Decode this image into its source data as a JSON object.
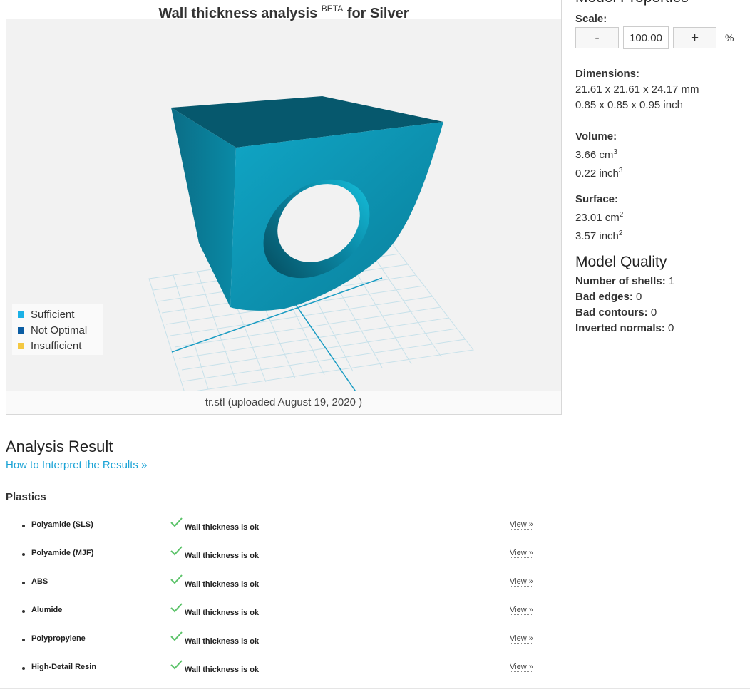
{
  "viewer": {
    "title": "Wall thickness analysis",
    "title_sup": "BETA",
    "title_suffix": "for Silver",
    "caption": "tr.stl (uploaded August 19, 2020 )",
    "legend": [
      {
        "label": "Sufficient",
        "color": "#1bb1e6"
      },
      {
        "label": "Not Optimal",
        "color": "#0b5da3"
      },
      {
        "label": "Insufficient",
        "color": "#f4c842"
      }
    ],
    "model_color": "#0a8aa6"
  },
  "properties": {
    "title": "Model Properties",
    "scale_label": "Scale:",
    "scale_minus": "-",
    "scale_value": "100.00",
    "scale_plus": "+",
    "scale_unit": "%",
    "dimensions_label": "Dimensions:",
    "dimensions_mm": "21.61 x 21.61 x 24.17 mm",
    "dimensions_inch": "0.85 x 0.85 x 0.95 inch",
    "volume_label": "Volume:",
    "volume_cm": "3.66 cm",
    "volume_cm_exp": "3",
    "volume_inch": "0.22 inch",
    "volume_inch_exp": "3",
    "surface_label": "Surface:",
    "surface_cm": "23.01 cm",
    "surface_cm_exp": "2",
    "surface_inch": "3.57 inch",
    "surface_inch_exp": "2"
  },
  "quality": {
    "title": "Model Quality",
    "items": [
      {
        "label": "Number of shells:",
        "value": "1"
      },
      {
        "label": "Bad edges:",
        "value": "0"
      },
      {
        "label": "Bad contours:",
        "value": "0"
      },
      {
        "label": "Inverted normals:",
        "value": "0"
      }
    ]
  },
  "analysis": {
    "title": "Analysis Result",
    "interpret_link": "How to Interpret the Results »",
    "group_title": "Plastics",
    "status_color": "#5cc36a",
    "materials": [
      {
        "name": "Polyamide (SLS)",
        "status": "Wall thickness is ok",
        "view": "View »"
      },
      {
        "name": "Polyamide (MJF)",
        "status": "Wall thickness is ok",
        "view": "View »"
      },
      {
        "name": "ABS",
        "status": "Wall thickness is ok",
        "view": "View »"
      },
      {
        "name": "Alumide",
        "status": "Wall thickness is ok",
        "view": "View »"
      },
      {
        "name": "Polypropylene",
        "status": "Wall thickness is ok",
        "view": "View »"
      },
      {
        "name": "High-Detail Resin",
        "status": "Wall thickness is ok",
        "view": "View »"
      }
    ]
  }
}
